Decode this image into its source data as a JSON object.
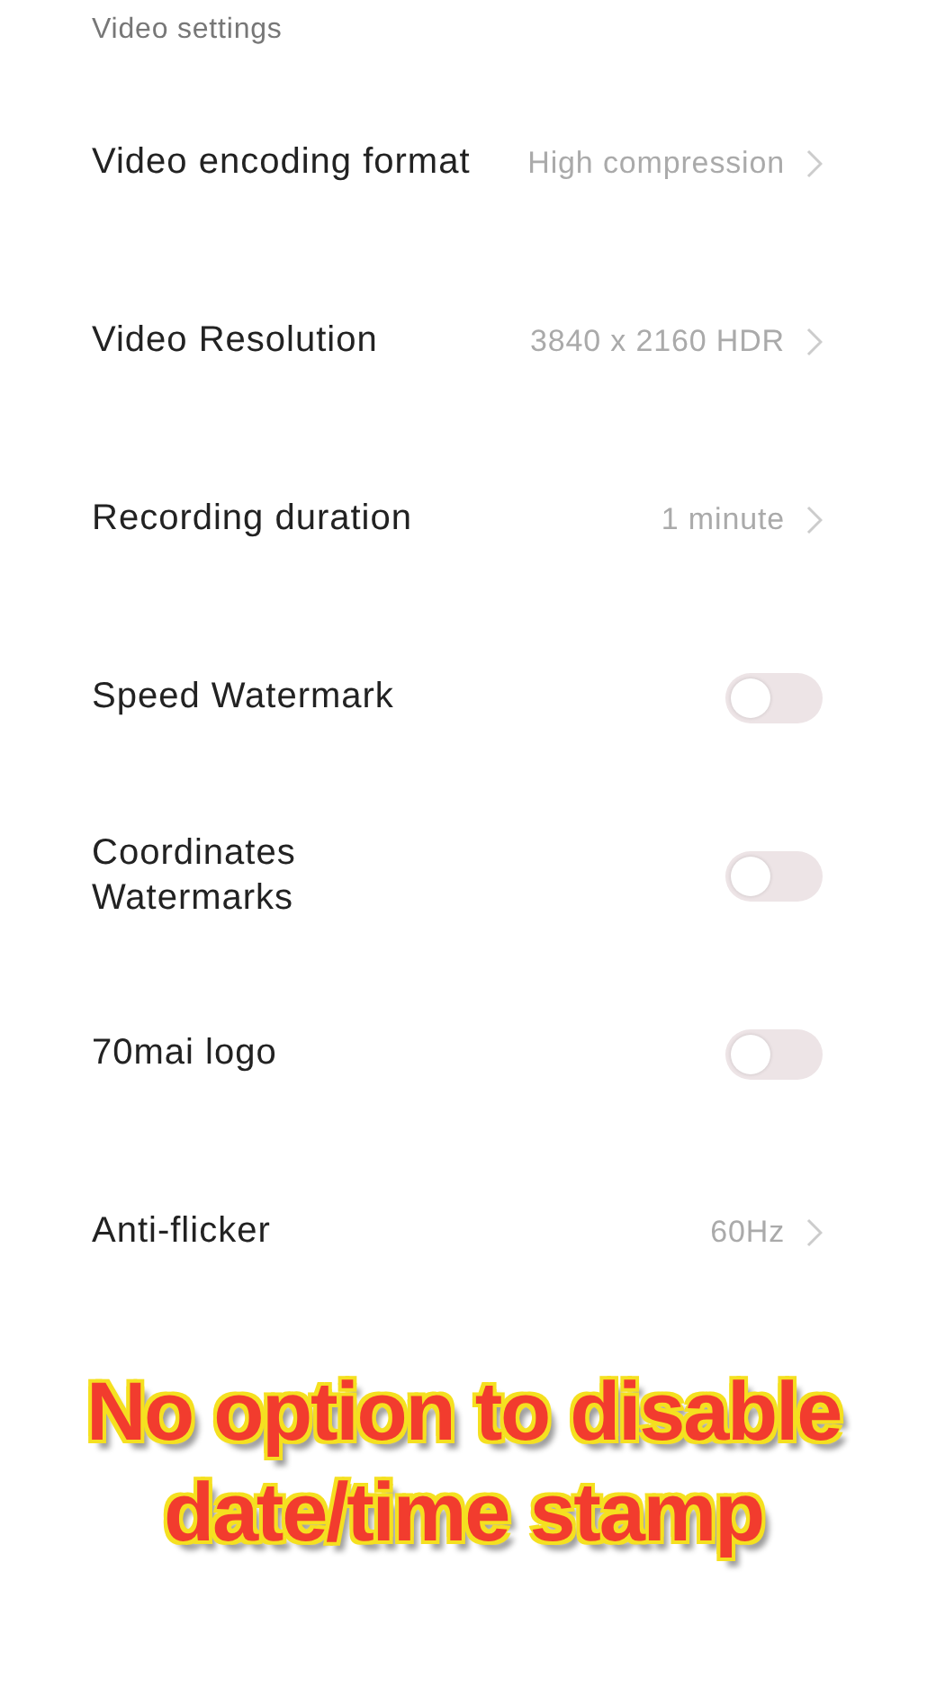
{
  "section_title": "Video settings",
  "rows": [
    {
      "kind": "link",
      "label": "Video encoding format",
      "value": "High compression"
    },
    {
      "kind": "link",
      "label": "Video Resolution",
      "value": "3840 x 2160 HDR"
    },
    {
      "kind": "link",
      "label": "Recording duration",
      "value": "1 minute"
    },
    {
      "kind": "toggle",
      "label": "Speed Watermark",
      "on": false
    },
    {
      "kind": "toggle",
      "label": "Coordinates Watermarks",
      "on": false
    },
    {
      "kind": "toggle",
      "label": "70mai logo",
      "on": false
    },
    {
      "kind": "link",
      "label": "Anti-flicker",
      "value": "60Hz"
    }
  ],
  "caption": [
    "No option to disable",
    "date/time stamp"
  ]
}
